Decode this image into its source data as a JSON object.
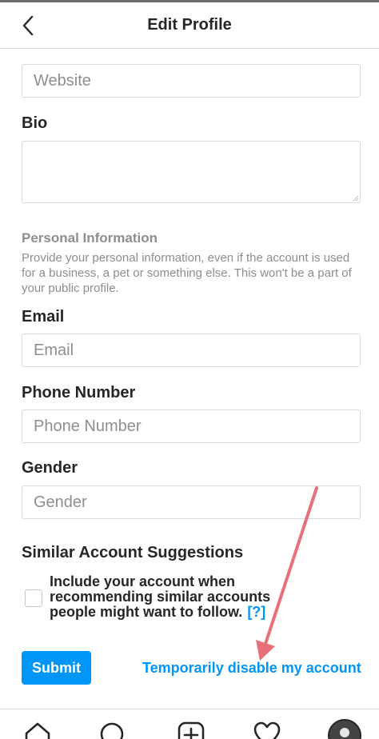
{
  "header": {
    "title": "Edit Profile"
  },
  "website": {
    "label": "Website",
    "placeholder": "Website"
  },
  "bio": {
    "label": "Bio"
  },
  "personal_info": {
    "title": "Personal Information",
    "description": "Provide your personal information, even if the account is used for a business, a pet or something else. This won't be a part of your public profile."
  },
  "email": {
    "label": "Email",
    "placeholder": "Email"
  },
  "phone": {
    "label": "Phone Number",
    "placeholder": "Phone Number"
  },
  "gender": {
    "label": "Gender",
    "placeholder": "Gender"
  },
  "suggestions": {
    "label": "Similar Account Suggestions",
    "checkbox_text": "Include your account when recommending similar accounts people might want to follow.",
    "help_link": "[?]"
  },
  "actions": {
    "submit_label": "Submit",
    "disable_link": "Temporarily disable my account"
  },
  "annotation": {
    "arrow_color": "#e8707a"
  },
  "tabs": [
    "home-icon",
    "search-icon",
    "new-post-icon",
    "activity-heart-icon",
    "profile-avatar"
  ]
}
